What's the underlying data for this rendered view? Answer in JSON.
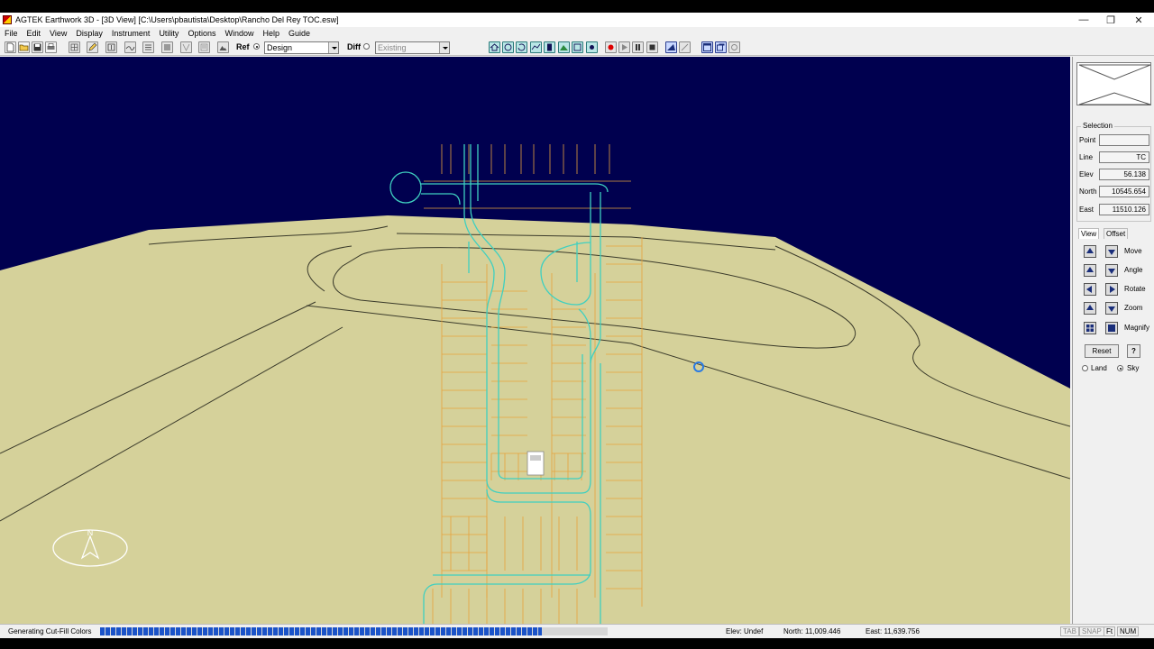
{
  "window": {
    "title": "AGTEK Earthwork 3D - [3D View]  [C:\\Users\\pbautista\\Desktop\\Rancho Del Rey TOC.esw]",
    "controls": {
      "minimize": "—",
      "restore": "❐",
      "close": "✕"
    }
  },
  "menu": [
    "File",
    "Edit",
    "View",
    "Display",
    "Instrument",
    "Utility",
    "Options",
    "Window",
    "Help",
    "Guide"
  ],
  "toolbar": {
    "ref_label": "Ref",
    "ref_selected": true,
    "ref_value": "Design",
    "diff_label": "Diff",
    "diff_selected": false,
    "diff_value": "Existing"
  },
  "panel": {
    "selection": {
      "title": "Selection",
      "fields": [
        {
          "label": "Point",
          "value": ""
        },
        {
          "label": "Line",
          "value": "TC"
        },
        {
          "label": "Elev",
          "value": "56.138"
        },
        {
          "label": "North",
          "value": "10545.654"
        },
        {
          "label": "East",
          "value": "11510.126"
        }
      ]
    },
    "tabs": [
      {
        "label": "View",
        "active": true
      },
      {
        "label": "Offset",
        "active": false
      }
    ],
    "controls": [
      "Move",
      "Angle",
      "Rotate",
      "Zoom",
      "Magnify"
    ],
    "reset_label": "Reset",
    "help_label": "?",
    "land_label": "Land",
    "sky_label": "Sky",
    "sky_selected": true
  },
  "statusbar": {
    "message": "Generating Cut-Fill Colors",
    "progress": 0.87,
    "elev": "Elev: Undef",
    "north": "North: 11,009.446",
    "east": "East: 11,639.756",
    "indicators": [
      {
        "label": "TAB",
        "active": false
      },
      {
        "label": "SNAP",
        "active": false
      },
      {
        "label": "Ft",
        "active": true
      },
      {
        "label": "NUM",
        "active": true
      }
    ]
  },
  "compass": {
    "label": "N"
  },
  "colors": {
    "sky": "#00004f",
    "terrain": "#d5d19a",
    "design_lines": "#e6a23c",
    "curb_lines": "#3fd0c0",
    "progress": "#1a53c9"
  }
}
